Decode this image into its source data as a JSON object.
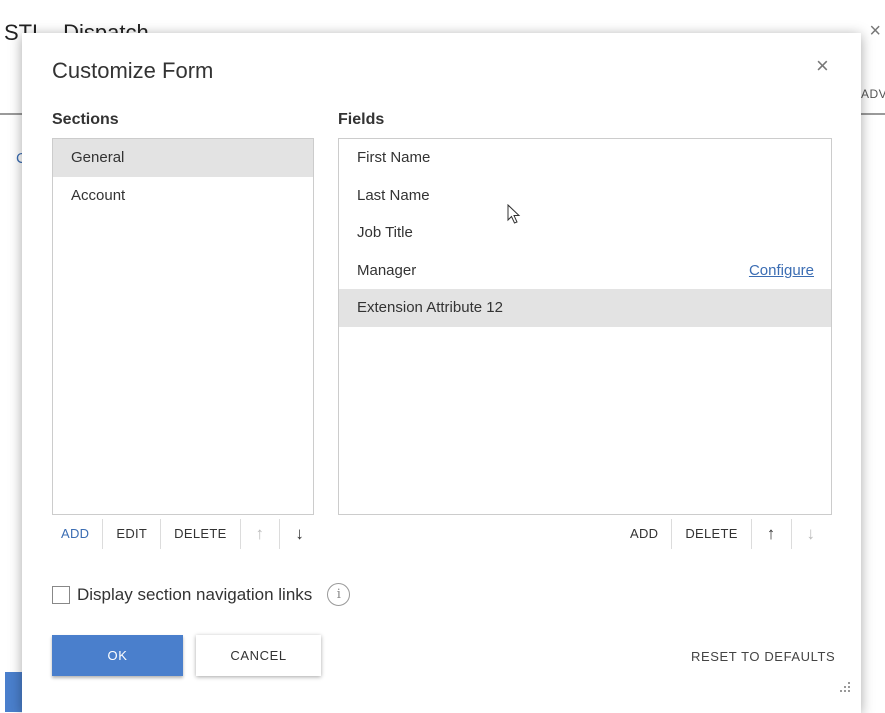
{
  "background": {
    "title": "STL - Dispatch",
    "close": "×",
    "tab_fragment": "ADVANCED"
  },
  "dialog": {
    "title": "Customize Form",
    "close": "×"
  },
  "sections": {
    "label": "Sections",
    "items": [
      {
        "label": "General",
        "selected": true
      },
      {
        "label": "Account",
        "selected": false
      }
    ],
    "toolbar": {
      "add": "ADD",
      "edit": "EDIT",
      "delete": "DELETE",
      "up": "↑",
      "down": "↓"
    }
  },
  "fields": {
    "label": "Fields",
    "items": [
      {
        "label": "First Name"
      },
      {
        "label": "Last Name"
      },
      {
        "label": "Job Title"
      },
      {
        "label": "Manager",
        "link": "Configure"
      },
      {
        "label": "Extension Attribute 12",
        "selected": true
      }
    ],
    "toolbar": {
      "add": "ADD",
      "delete": "DELETE",
      "up": "↑",
      "down": "↓"
    }
  },
  "options": {
    "nav_links_label": "Display section navigation links",
    "nav_links_checked": false,
    "info_glyph": "i"
  },
  "footer": {
    "ok": "OK",
    "cancel": "CANCEL",
    "reset": "RESET TO DEFAULTS"
  },
  "colors": {
    "primary": "#4a7fcc",
    "link": "#3b6db3",
    "selected_row": "#e3e3e3"
  }
}
